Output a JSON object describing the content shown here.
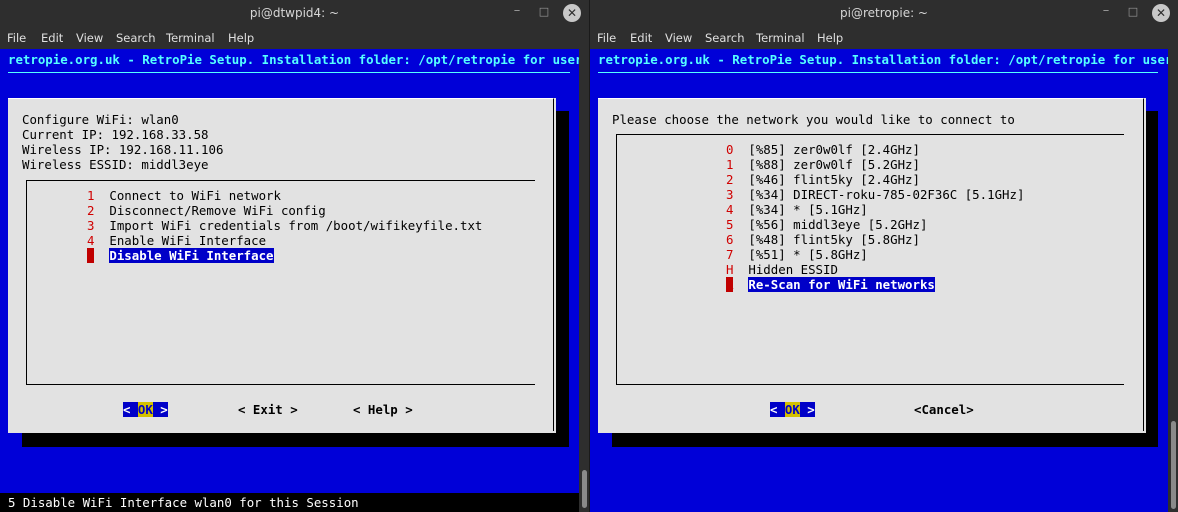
{
  "left": {
    "title": "pi@dtwpid4: ~",
    "menu": [
      "File",
      "Edit",
      "View",
      "Search",
      "Terminal",
      "Help"
    ],
    "backtitle": "retropie.org.uk - RetroPie Setup. Installation folder: /opt/retropie for user",
    "info": [
      "Configure WiFi: wlan0",
      "Current IP: 192.168.33.58",
      "Wireless IP: 192.168.11.106",
      "Wireless ESSID: middl3eye"
    ],
    "items": [
      {
        "tag": "1",
        "label": "Connect to WiFi network"
      },
      {
        "tag": "2",
        "label": "Disconnect/Remove WiFi config"
      },
      {
        "tag": "3",
        "label": "Import WiFi credentials from /boot/wifikeyfile.txt"
      },
      {
        "tag": "4",
        "label": "Enable WiFi Interface"
      },
      {
        "tag": "5",
        "label": "Disable WiFi Interface"
      }
    ],
    "buttons": {
      "ok_open": "< ",
      "ok": "OK",
      "ok_close": " >",
      "exit": "< Exit >",
      "help": "< Help >"
    },
    "status": "5 Disable WiFi Interface wlan0 for this Session"
  },
  "right": {
    "title": "pi@retropie: ~",
    "menu": [
      "File",
      "Edit",
      "View",
      "Search",
      "Terminal",
      "Help"
    ],
    "backtitle": "retropie.org.uk - RetroPie Setup. Installation folder: /opt/retropie for user",
    "prompt": "Please choose the network you would like to connect to",
    "items": [
      {
        "tag": "0",
        "label": "[%85] zer0w0lf [2.4GHz]"
      },
      {
        "tag": "1",
        "label": "[%88] zer0w0lf [5.2GHz]"
      },
      {
        "tag": "2",
        "label": "[%46] flint5ky [2.4GHz]"
      },
      {
        "tag": "3",
        "label": "[%34] DIRECT-roku-785-02F36C [5.1GHz]"
      },
      {
        "tag": "4",
        "label": "[%34] * [5.1GHz]"
      },
      {
        "tag": "5",
        "label": "[%56] middl3eye [5.2GHz]"
      },
      {
        "tag": "6",
        "label": "[%48] flint5ky [5.8GHz]"
      },
      {
        "tag": "7",
        "label": "[%51] * [5.8GHz]"
      },
      {
        "tag": "H",
        "label": "Hidden ESSID"
      },
      {
        "tag": "R",
        "label": "Re-Scan for WiFi networks"
      }
    ],
    "buttons": {
      "ok_open": "< ",
      "ok": "OK",
      "ok_close": " >",
      "cancel": "<Cancel>"
    }
  },
  "window_controls": {
    "minimize": "–",
    "maximize": "□",
    "close": "✕"
  }
}
